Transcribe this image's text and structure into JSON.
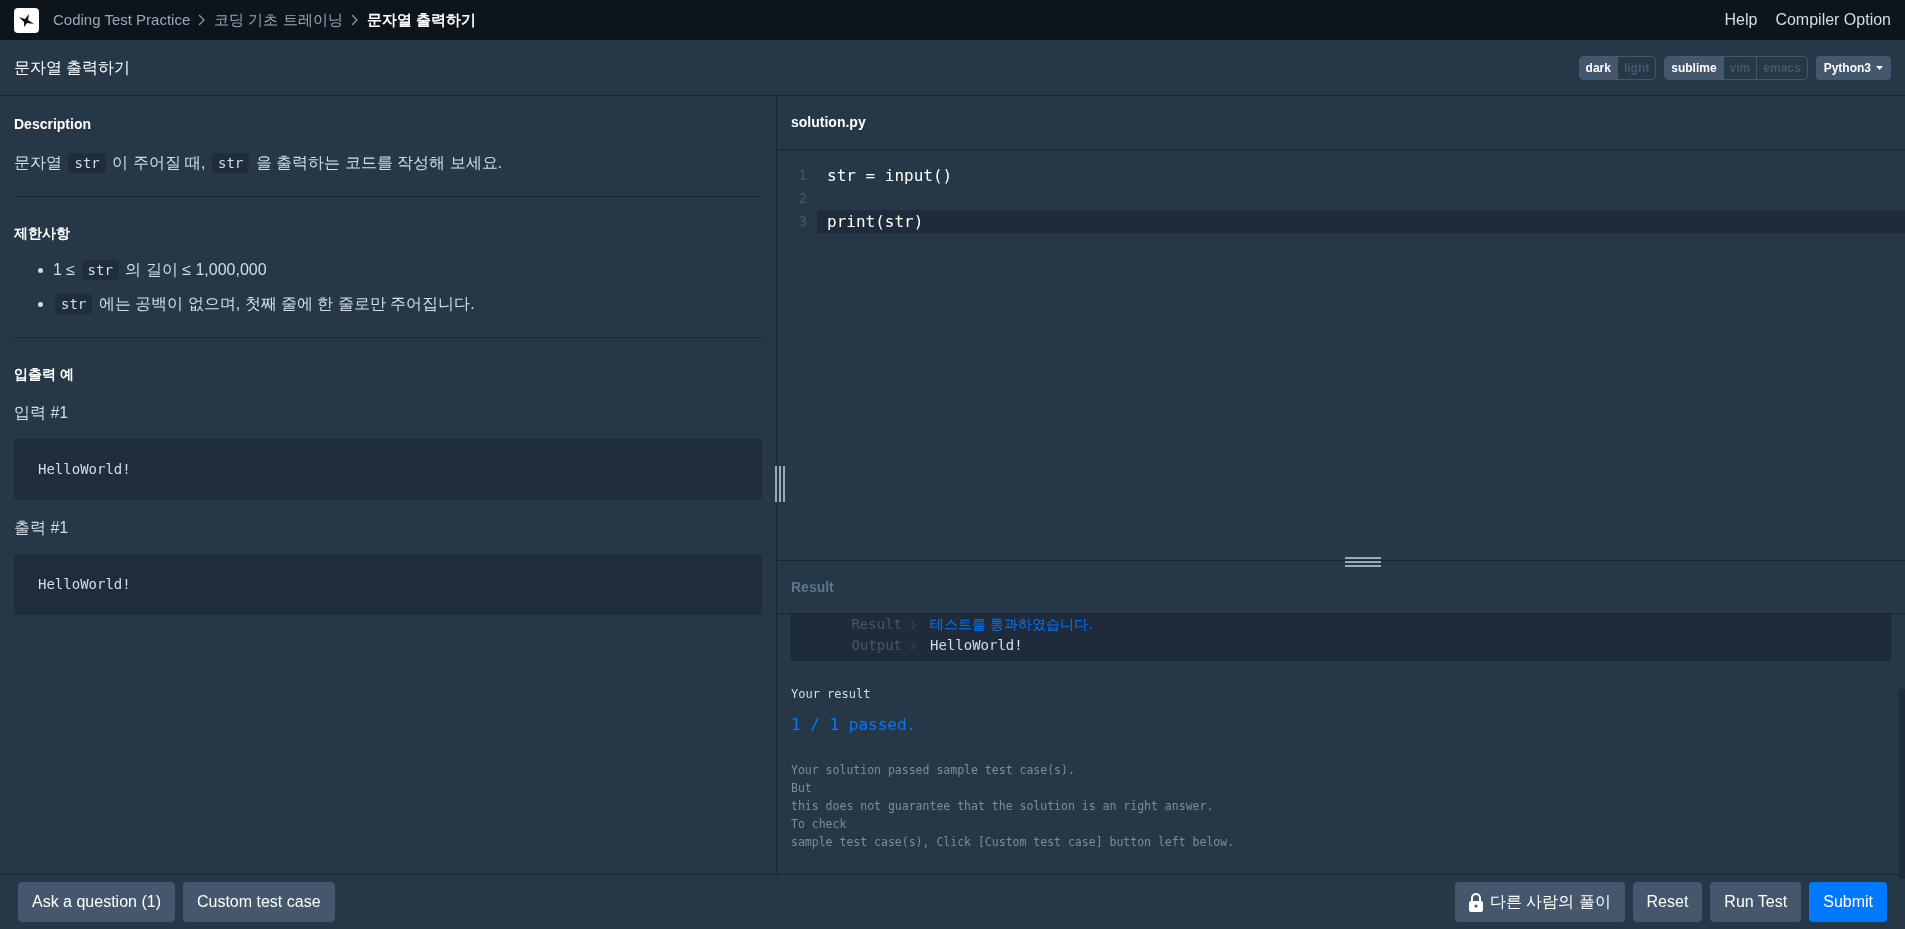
{
  "breadcrumb": [
    {
      "label": "Coding Test Practice",
      "current": false
    },
    {
      "label": "코딩 기초 트레이닝",
      "current": false
    },
    {
      "label": "문자열 출력하기",
      "current": true
    }
  ],
  "top_links": [
    "Help",
    "Compiler Option"
  ],
  "problem_title": "문자열 출력하기",
  "theme_toggle": [
    {
      "label": "dark",
      "selected": true
    },
    {
      "label": "light",
      "selected": false
    }
  ],
  "keymap_toggle": [
    {
      "label": "sublime",
      "selected": true
    },
    {
      "label": "vim",
      "selected": false
    },
    {
      "label": "emacs",
      "selected": false
    }
  ],
  "language": "Python3",
  "description": {
    "heading": "Description",
    "parts": [
      {
        "kind": "text",
        "text": "문자열 "
      },
      {
        "kind": "code",
        "text": "str"
      },
      {
        "kind": "text",
        "text": " 이 주어질 때, "
      },
      {
        "kind": "code",
        "text": "str"
      },
      {
        "kind": "text",
        "text": " 을 출력하는 코드를 작성해 보세요."
      }
    ]
  },
  "constraints": {
    "heading": "제한사항",
    "items": [
      [
        {
          "kind": "text",
          "text": "1 ≤ "
        },
        {
          "kind": "code",
          "text": "str"
        },
        {
          "kind": "text",
          "text": " 의 길이 ≤ 1,000,000"
        }
      ],
      [
        {
          "kind": "code",
          "text": "str"
        },
        {
          "kind": "text",
          "text": " 에는 공백이 없으며, 첫째 줄에 한 줄로만 주어집니다."
        }
      ]
    ]
  },
  "examples": {
    "heading": "입출력 예",
    "blocks": [
      {
        "label": "입력 #1",
        "value": "HelloWorld!"
      },
      {
        "label": "출력 #1",
        "value": "HelloWorld!"
      }
    ]
  },
  "editor": {
    "filename": "solution.py",
    "lines": [
      {
        "number": "1",
        "code": "str = input()",
        "active": false
      },
      {
        "number": "2",
        "active": false
      },
      {
        "number": "3",
        "code": "print(str)",
        "active": true
      }
    ]
  },
  "result": {
    "heading": "Result",
    "rows": [
      {
        "kind": "status",
        "label": "Result",
        "value": "테스트를 통과하였습니다."
      },
      {
        "kind": "output",
        "label": "Output",
        "value": "HelloWorld!"
      }
    ],
    "summary_label": "Your result",
    "summary": "1 / 1 passed.",
    "message": [
      "Your solution passed sample test case(s).",
      "But",
      "this does not guarantee that the solution is an right answer.",
      "To check",
      "sample test case(s), Click [Custom test case] button left below."
    ]
  },
  "left_buttons": [
    "Ask a question (1)",
    "Custom test case"
  ],
  "right_buttons": [
    {
      "kind": "locked",
      "label": "다른 사람의 풀이"
    },
    {
      "kind": "plain",
      "label": "Reset"
    },
    {
      "kind": "plain",
      "label": "Run Test"
    },
    {
      "kind": "primary",
      "label": "Submit"
    }
  ]
}
